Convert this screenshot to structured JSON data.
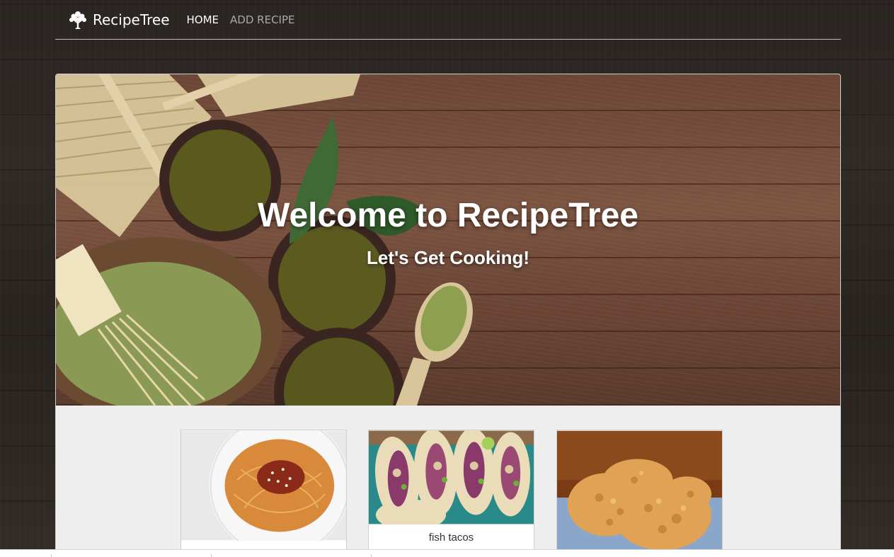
{
  "navbar": {
    "brand": "RecipeTree",
    "brand_icon": "tree-icon",
    "links": [
      {
        "label": "HOME",
        "active": true
      },
      {
        "label": "ADD RECIPE",
        "active": false
      }
    ]
  },
  "hero": {
    "title": "Welcome to RecipeTree",
    "subtitle": "Let's Get Cooking!"
  },
  "recipes": [
    {
      "title": "",
      "image": "spaghetti-photo"
    },
    {
      "title": "fish tacos",
      "image": "fish-tacos-photo"
    },
    {
      "title": "",
      "image": "fried-chicken-photo"
    }
  ],
  "colors": {
    "nav_active": "#ffffff",
    "nav_muted": "#a9a9a9",
    "content_bg": "#eeeeee"
  }
}
